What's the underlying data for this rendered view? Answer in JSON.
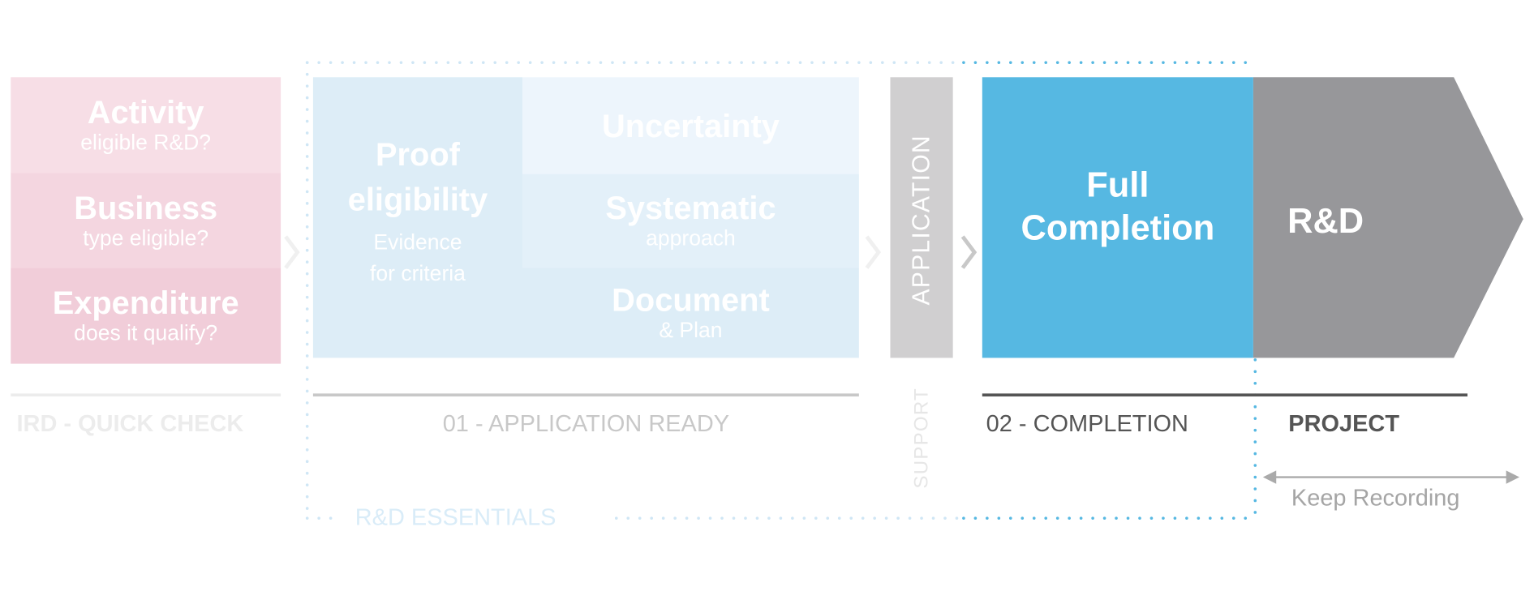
{
  "quick_check": {
    "rows": [
      {
        "title": "Activity",
        "subtitle": "eligible R&D?"
      },
      {
        "title": "Business",
        "subtitle": "type eligible?"
      },
      {
        "title": "Expenditure",
        "subtitle": "does it qualify?"
      }
    ],
    "label": "IRD - QUICK CHECK"
  },
  "application_ready": {
    "proof": {
      "title_line1": "Proof",
      "title_line2": "eligibility",
      "sub_line1": "Evidence",
      "sub_line2": "for criteria"
    },
    "rows": [
      {
        "title": "Uncertainty",
        "subtitle": ""
      },
      {
        "title": "Systematic",
        "subtitle": "approach"
      },
      {
        "title": "Document",
        "subtitle": "& Plan"
      }
    ],
    "label": "01 - APPLICATION READY"
  },
  "application_bar": {
    "label": "APPLICATION",
    "below_label": "SUPPORT"
  },
  "completion": {
    "title_line1": "Full",
    "title_line2": "Completion",
    "label": "02 - COMPLETION"
  },
  "project": {
    "title": "R&D",
    "label": "PROJECT",
    "range_label": "Keep Recording"
  },
  "essentials_label": "R&D ESSENTIALS",
  "colors": {
    "pink_rows": [
      "#f7dee6",
      "#f4d6e0",
      "#f1cdd9"
    ],
    "light_blue": "#ddedf7",
    "accent_blue": "#56b8e2",
    "gray_arrow": "#97979a",
    "application_gray": "#d0cfd0"
  }
}
